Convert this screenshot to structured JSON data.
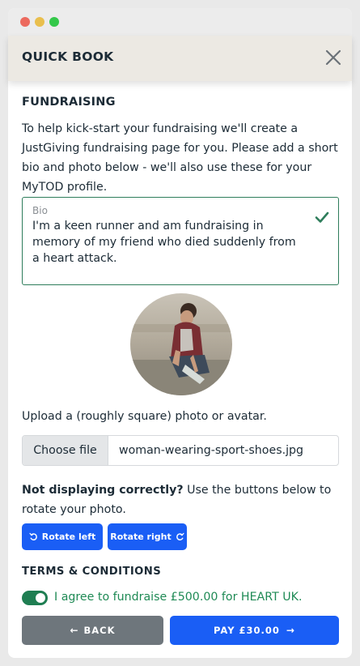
{
  "window": {
    "controls": [
      "close",
      "minimize",
      "maximize"
    ]
  },
  "modal": {
    "title": "QUICK BOOK",
    "close_icon": "close-icon"
  },
  "fundraising": {
    "title": "FUNDRAISING",
    "intro": "To help kick-start your fundraising we'll create a JustGiving fundraising page for you. Please add a short bio and photo below - we'll also use these for your MyTOD profile."
  },
  "bio": {
    "label": "Bio",
    "value": "I'm a keen runner and am fundraising in memory of my friend who died suddenly from a heart attack.",
    "status_icon": "check-icon"
  },
  "upload": {
    "label": "Upload a (roughly square) photo or avatar.",
    "choose_label": "Choose file",
    "file_name": "woman-wearing-sport-shoes.jpg"
  },
  "rotate": {
    "note_bold": "Not displaying correctly?",
    "note_rest": " Use the buttons below to rotate your photo.",
    "left_label": "Rotate left",
    "right_label": "Rotate right"
  },
  "terms": {
    "title": "TERMS & CONDITIONS",
    "agree_text": "I agree to fundraise £500.00 for HEART UK.",
    "agreed": true
  },
  "actions": {
    "back_label": "BACK",
    "pay_label": "PAY £30.00"
  },
  "colors": {
    "primary": "#1a5ef5",
    "success": "#1f7e52",
    "back": "#6e767c",
    "header_bg": "#ece9e3"
  }
}
